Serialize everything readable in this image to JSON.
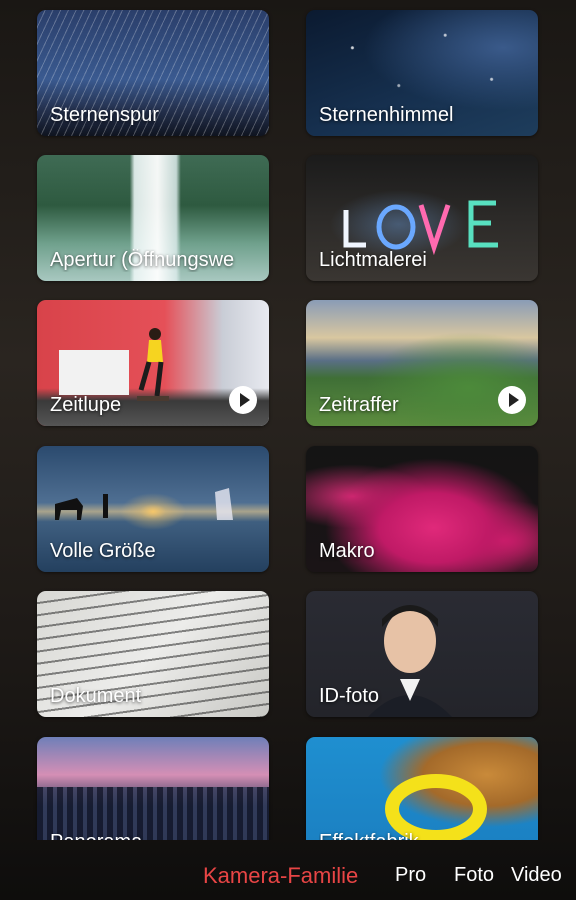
{
  "tiles": [
    {
      "label": "Sternenspur",
      "name": "tile-sternenspur",
      "video": false
    },
    {
      "label": "Sternenhimmel",
      "name": "tile-sternenhimmel",
      "video": false
    },
    {
      "label": "Apertur (Öffnungswe",
      "name": "tile-apertur",
      "video": false
    },
    {
      "label": "Lichtmalerei",
      "name": "tile-lichtmalerei",
      "video": false
    },
    {
      "label": "Zeitlupe",
      "name": "tile-zeitlupe",
      "video": true
    },
    {
      "label": "Zeitraffer",
      "name": "tile-zeitraffer",
      "video": true
    },
    {
      "label": "Volle Größe",
      "name": "tile-volle-groesse",
      "video": false
    },
    {
      "label": "Makro",
      "name": "tile-makro",
      "video": false
    },
    {
      "label": "Dokument",
      "name": "tile-dokument",
      "video": false
    },
    {
      "label": "ID-foto",
      "name": "tile-id-foto",
      "video": false
    },
    {
      "label": "Panorama",
      "name": "tile-panorama",
      "video": false
    },
    {
      "label": "Effektfabrik",
      "name": "tile-effektfabrik",
      "video": false
    }
  ],
  "mode_bar": {
    "active_color": "#e84545",
    "items": [
      {
        "label": "Kamera-Familie",
        "active": true
      },
      {
        "label": "Pro",
        "active": false
      },
      {
        "label": "Foto",
        "active": false
      },
      {
        "label": "Video",
        "active": false
      }
    ]
  },
  "icons": {
    "play": "play-circle-icon"
  }
}
